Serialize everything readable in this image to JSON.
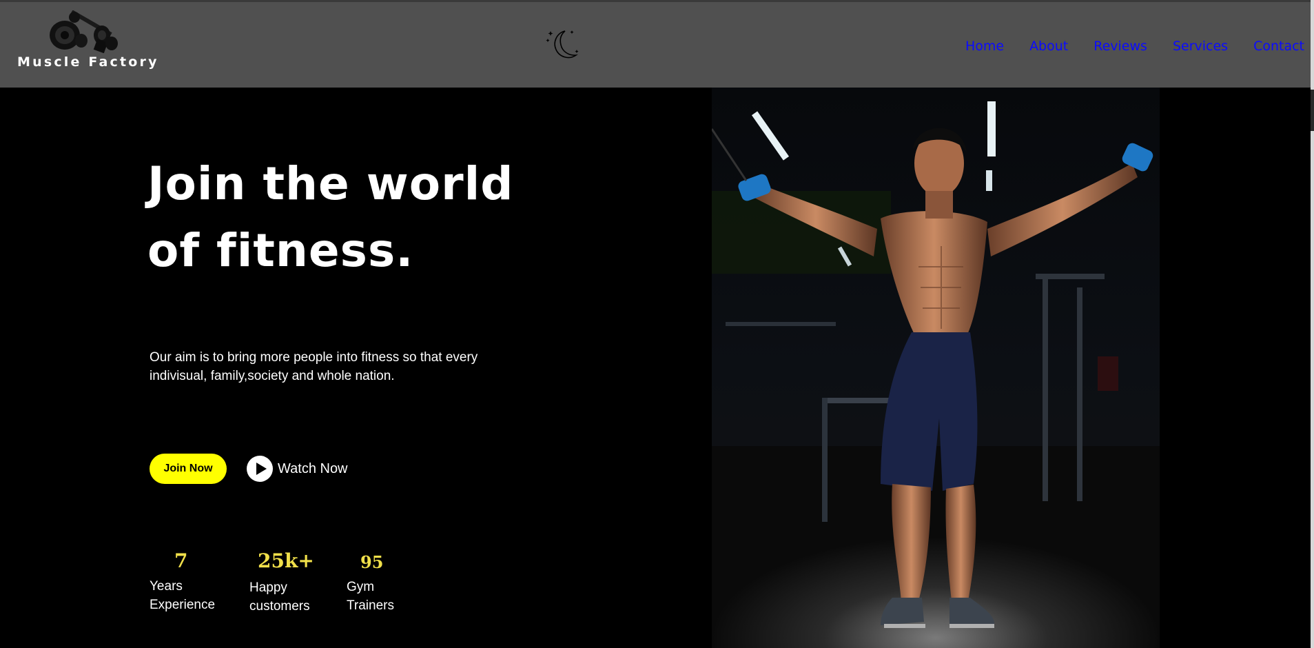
{
  "header": {
    "logo_text": "Muscle Factory",
    "nav": [
      "Home",
      "About",
      "Reviews",
      "Services",
      "Contact"
    ]
  },
  "hero": {
    "title": "Join the world of fitness.",
    "description": "Our aim is to bring more people into fitness so that every indivisual, family,society and whole nation.",
    "join_label": "Join Now",
    "watch_label": "Watch Now"
  },
  "stats": [
    {
      "value": "7",
      "label": "Years\nExperience"
    },
    {
      "value": "25k+",
      "label": "Happy\ncustomers"
    },
    {
      "value": "95",
      "label": "Gym\nTrainers"
    }
  ],
  "colors": {
    "header_bg": "#505050",
    "nav_link": "#0b0bff",
    "accent_yellow": "#ffff00",
    "stat_number": "#f1e04a"
  },
  "icons": {
    "logo": "dumbbell-icon",
    "theme_toggle": "moon-icon",
    "play": "play-icon"
  }
}
